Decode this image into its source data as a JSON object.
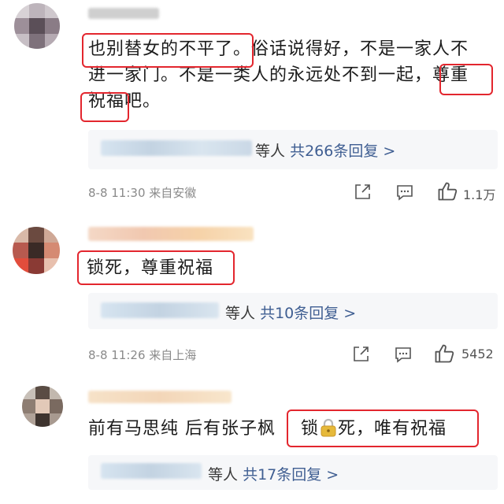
{
  "comments": [
    {
      "text_lines": [
        "也别替女的不平了。俗话说得好，不是一家人不",
        "进一家门。不是一类人的永远处不到一起，尊重",
        "祝福吧。"
      ],
      "reply": {
        "suffix": "等人",
        "count_text": "共266条回复 >"
      },
      "time": "8-8 11:30",
      "location": "来自安徽",
      "likes": "1.1万"
    },
    {
      "text_lines": [
        "锁死，尊重祝福"
      ],
      "reply": {
        "suffix": "等人",
        "count_text": "共10条回复 >"
      },
      "time": "8-8 11:26",
      "location": "来自上海",
      "likes": "5452"
    },
    {
      "text_part1": "前有马思纯 后有张子枫",
      "text_part2_a": "锁",
      "text_part2_b": "死，唯有祝福",
      "reply": {
        "suffix": "等人",
        "count_text": "共17条回复 >"
      }
    }
  ],
  "colors": {
    "highlight": "#e3262e",
    "link": "#3f5e92",
    "meta": "#8a8a8a"
  }
}
